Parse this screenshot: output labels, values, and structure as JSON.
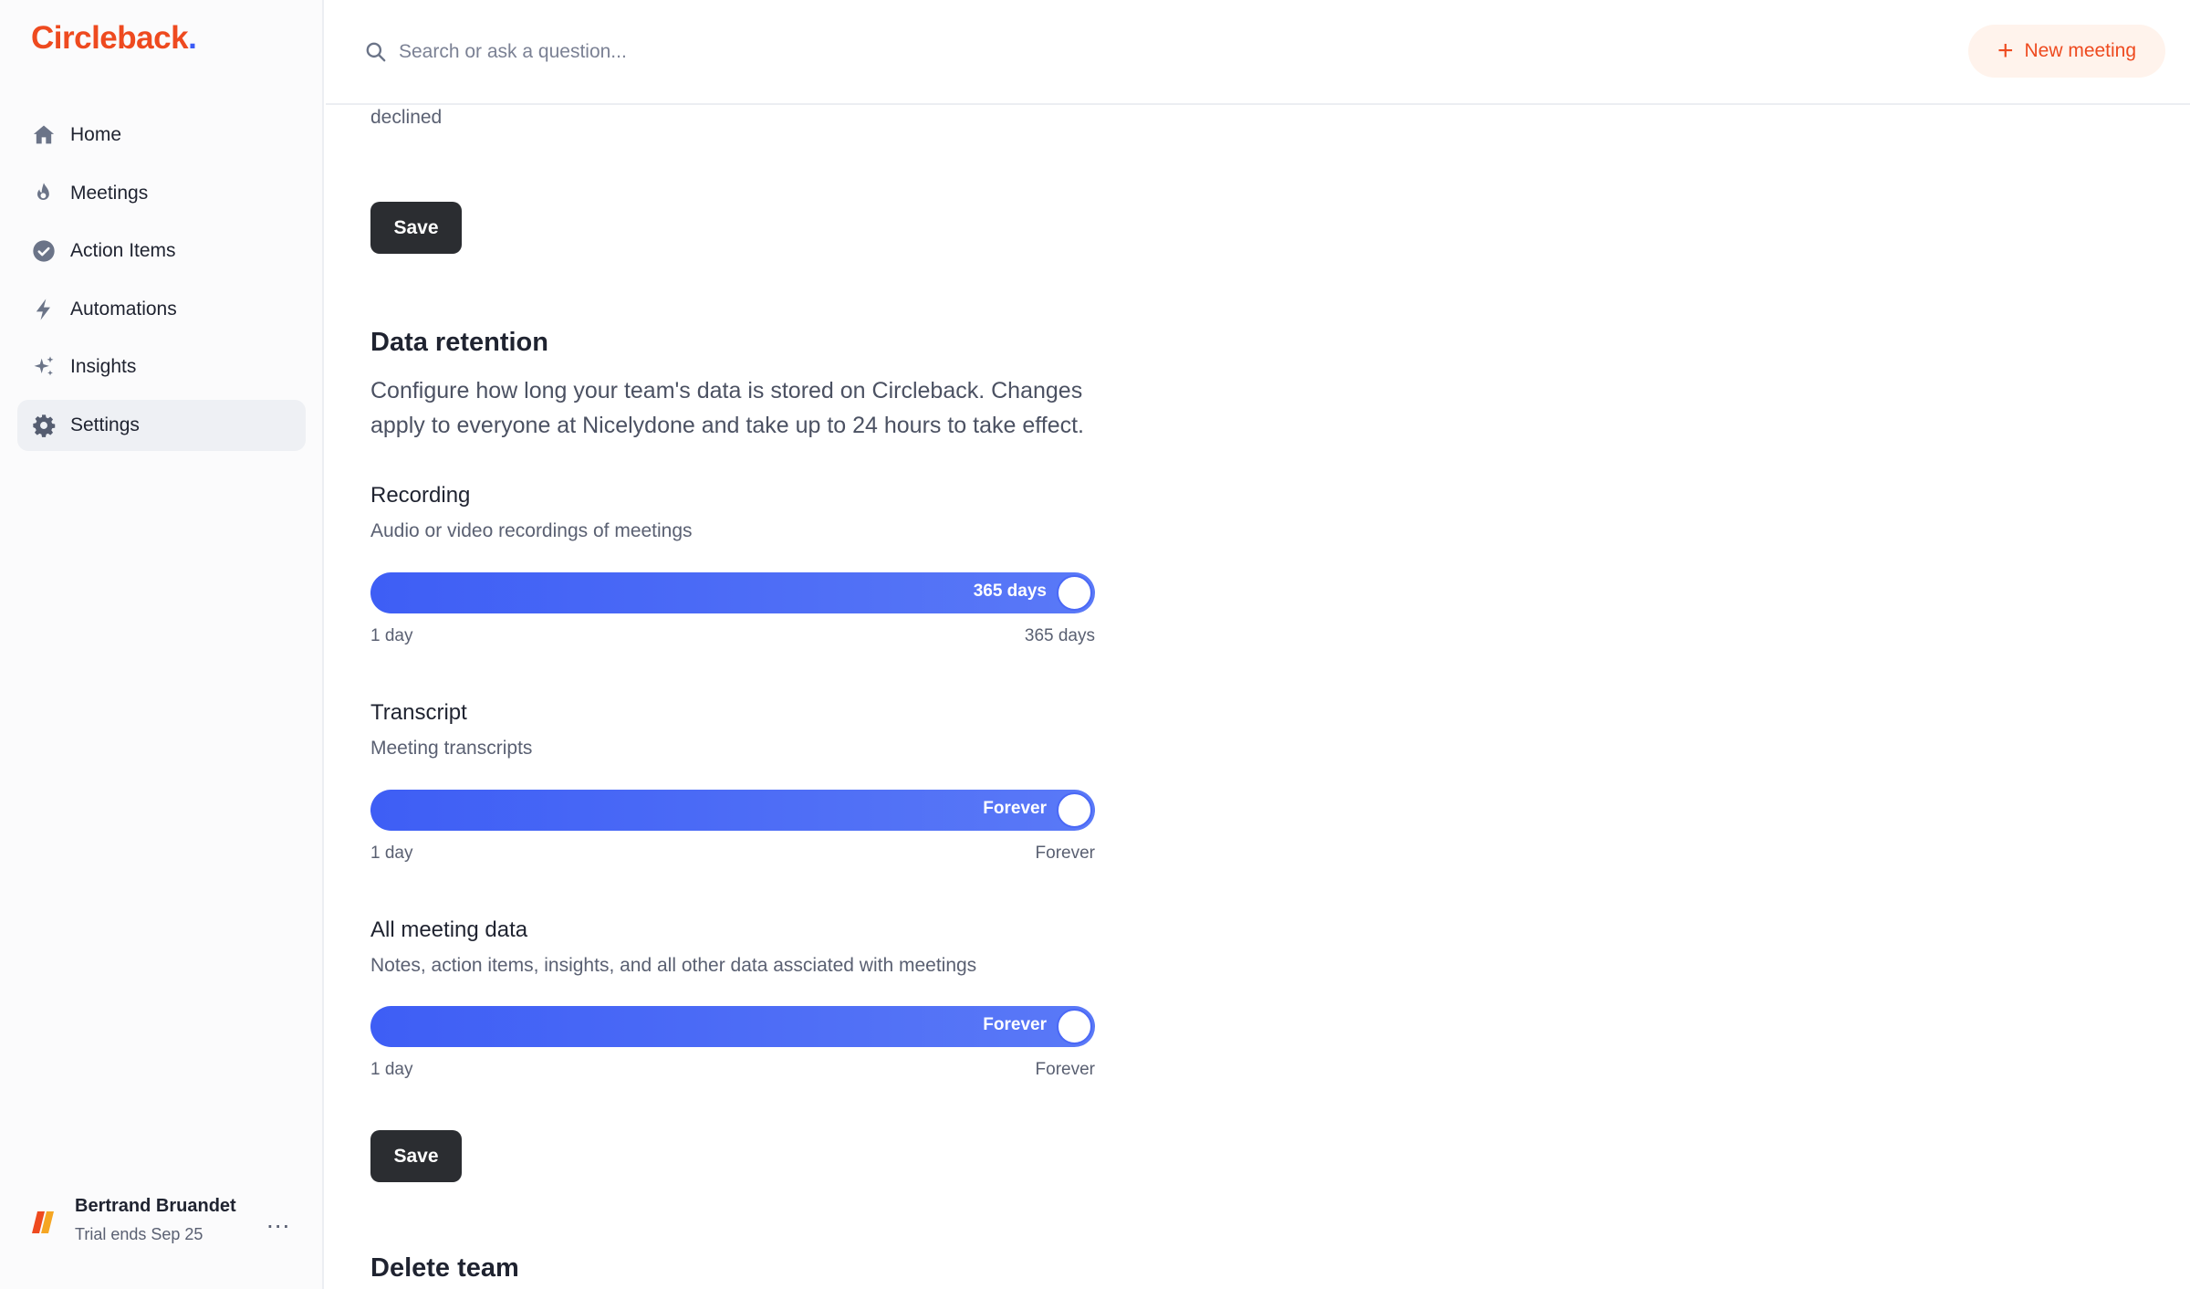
{
  "app": {
    "logo_text": "Circleback",
    "logo_dot": ".",
    "brand_color": "#ee4a1f",
    "accent_color": "#3b5bf6"
  },
  "sidebar": {
    "items": [
      {
        "label": "Home",
        "icon": "home-icon"
      },
      {
        "label": "Meetings",
        "icon": "flame-icon"
      },
      {
        "label": "Action Items",
        "icon": "check-circle-icon"
      },
      {
        "label": "Automations",
        "icon": "lightning-icon"
      },
      {
        "label": "Insights",
        "icon": "sparkles-icon"
      },
      {
        "label": "Settings",
        "icon": "gear-icon",
        "active": true
      }
    ],
    "user": {
      "name": "Bertrand Bruandet",
      "trial": "Trial ends Sep 25",
      "more": "..."
    }
  },
  "topbar": {
    "search_placeholder": "Search or ask a question...",
    "new_meeting_label": "New meeting",
    "new_meeting_plus": "+"
  },
  "main": {
    "declined_text": "declined",
    "save_label": "Save",
    "data_retention": {
      "title": "Data retention",
      "description": "Configure how long your team's data is stored on Circleback. Changes apply to everyone at Nicelydone and take up to 24 hours to take effect.",
      "items": [
        {
          "title": "Recording",
          "subtitle": "Audio or video recordings of meetings",
          "value": "365 days",
          "min": "1 day",
          "max": "365 days",
          "fill_fraction": 1.0
        },
        {
          "title": "Transcript",
          "subtitle": "Meeting transcripts",
          "value": "Forever",
          "min": "1 day",
          "max": "Forever",
          "fill_fraction": 1.0
        },
        {
          "title": "All meeting data",
          "subtitle": "Notes, action items, insights, and all other data assciated with meetings",
          "value": "Forever",
          "min": "1 day",
          "max": "Forever",
          "fill_fraction": 1.0
        }
      ],
      "save_label": "Save"
    },
    "delete_team_title": "Delete team"
  }
}
